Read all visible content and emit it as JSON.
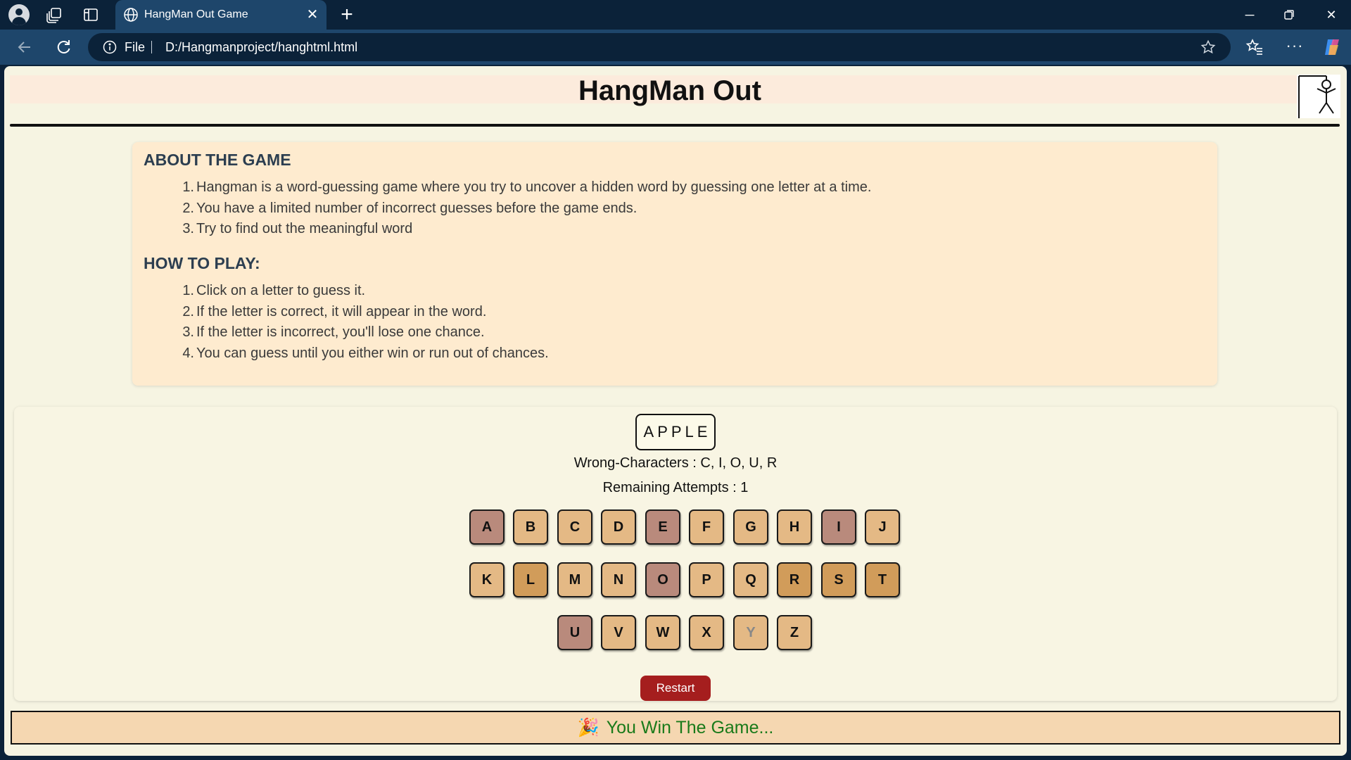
{
  "browser": {
    "tab_title": "HangMan Out Game",
    "address_scheme": "File",
    "url": "D:/Hangmanproject/hanghtml.html"
  },
  "page": {
    "title": "HangMan Out"
  },
  "about": {
    "heading": "ABOUT THE GAME",
    "items": [
      "Hangman is a word-guessing game where you try to uncover a hidden word by guessing one letter at a time.",
      "You have a limited number of incorrect guesses before the game ends.",
      "Try to find out the meaningful word"
    ]
  },
  "how_to": {
    "heading": "HOW TO PLAY:",
    "items": [
      "Click on a letter to guess it.",
      "If the letter is correct, it will appear in the word.",
      "If the letter is incorrect, you'll lose one chance.",
      "You can guess until you either win or run out of chances."
    ]
  },
  "game": {
    "word": "APPLE",
    "wrong_line": "Wrong-Characters : C, I, O, U, R",
    "remaining_line": "Remaining Attempts : 1",
    "keyboard_rows": [
      [
        "A",
        "B",
        "C",
        "D",
        "E",
        "F",
        "G",
        "H",
        "I",
        "J"
      ],
      [
        "K",
        "L",
        "M",
        "N",
        "O",
        "P",
        "Q",
        "R",
        "S",
        "T"
      ],
      [
        "U",
        "V",
        "W",
        "X",
        "Y",
        "Z"
      ]
    ],
    "restart_label": "Restart",
    "result_text": "You Win The Game..."
  },
  "colors": {
    "chrome_bg": "#0b2239",
    "toolbar_bg": "#1e466b",
    "page_bg": "#f6f4e2",
    "panel_bg": "#feebcf",
    "key_default": "#e4b985",
    "key_wrong_or_used": "#b98a7c",
    "key_darker": "#d19c5a",
    "restart_button": "#a51e1e",
    "win_text": "#1a7a1a"
  },
  "icons": {
    "tab": "globe-icon",
    "address": "info-icon",
    "favorite": "star-icon"
  }
}
